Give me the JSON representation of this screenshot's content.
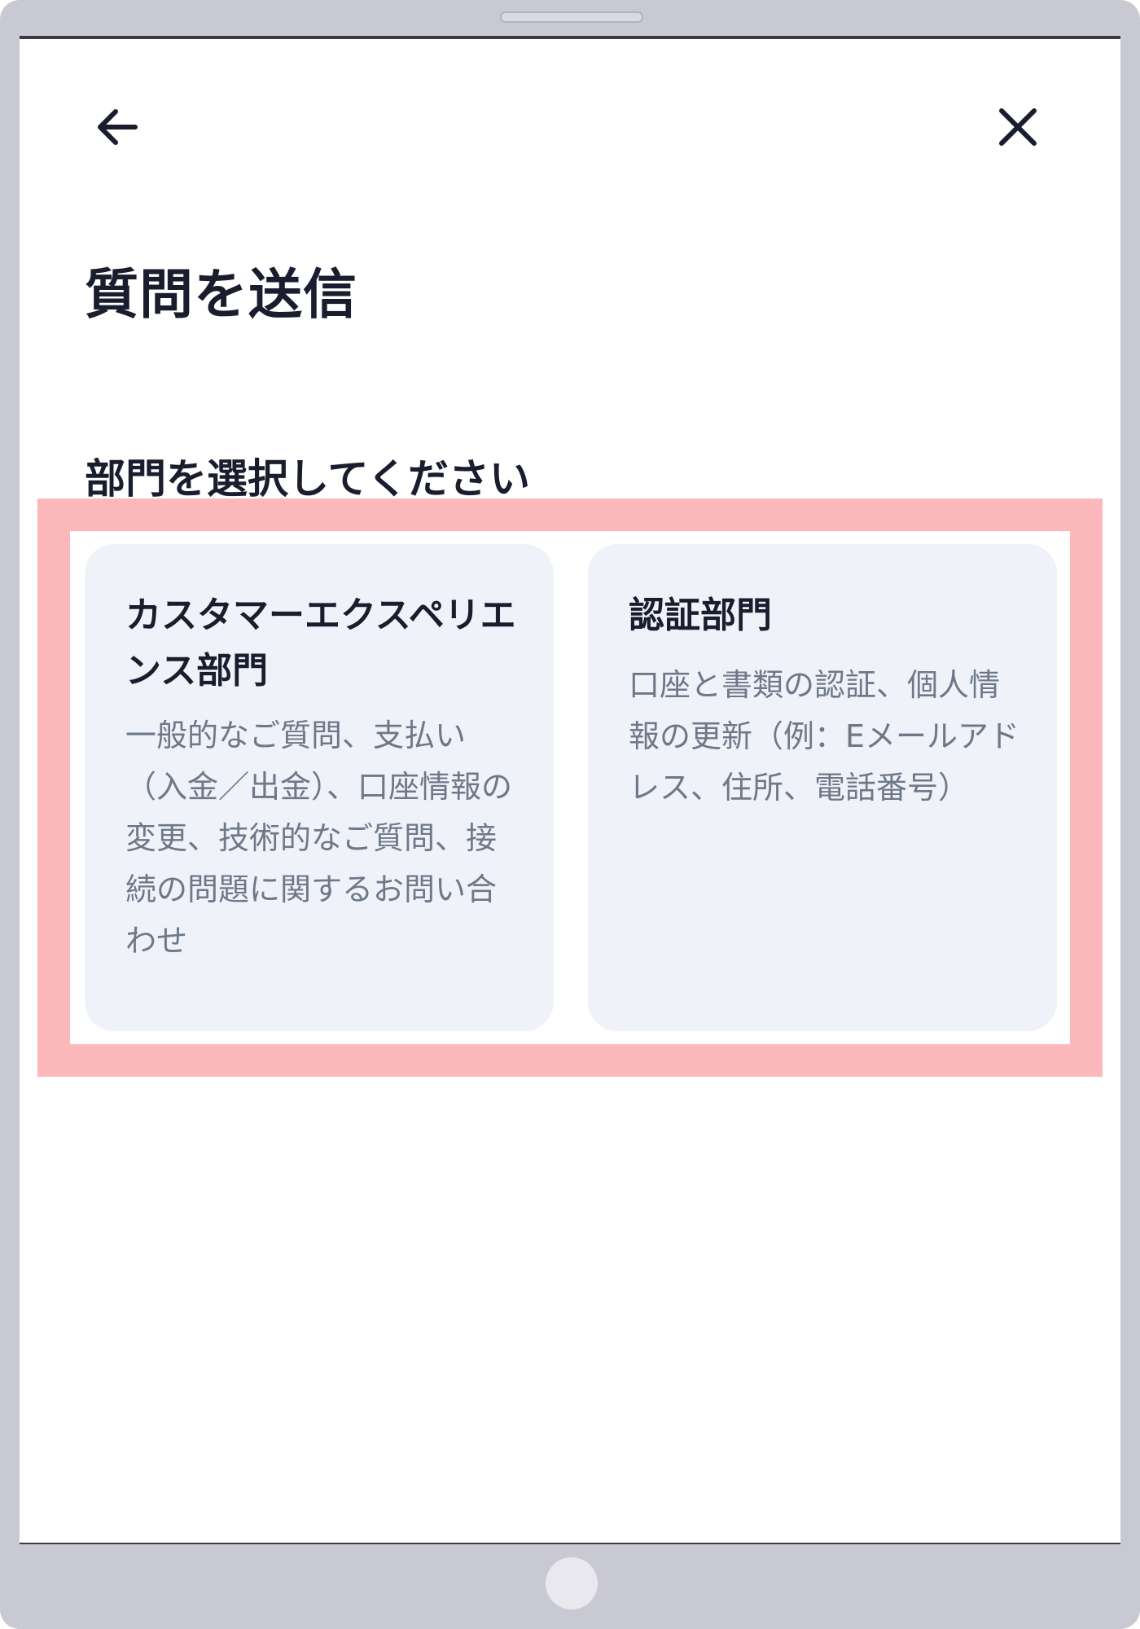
{
  "header": {
    "back_icon": "arrow-left-icon",
    "close_icon": "close-icon"
  },
  "page": {
    "title": "質問を送信",
    "section_label": "部門を選択してください"
  },
  "departments": [
    {
      "title": "カスタマーエクスペリエンス部門",
      "description": "一般的なご質問、支払い（入金／出金）、口座情報の変更、技術的なご質問、接続の問題に関するお問い合わせ"
    },
    {
      "title": "認証部門",
      "description": "口座と書類の認証、個人情報の更新（例：Eメールアドレス、住所、電話番号）"
    }
  ],
  "colors": {
    "device_frame": "#c9c9d4",
    "highlight": "#fdb8bb",
    "card_background": "#eff3f9",
    "title_text": "#1a1d2e",
    "description_text": "#6f7888"
  }
}
